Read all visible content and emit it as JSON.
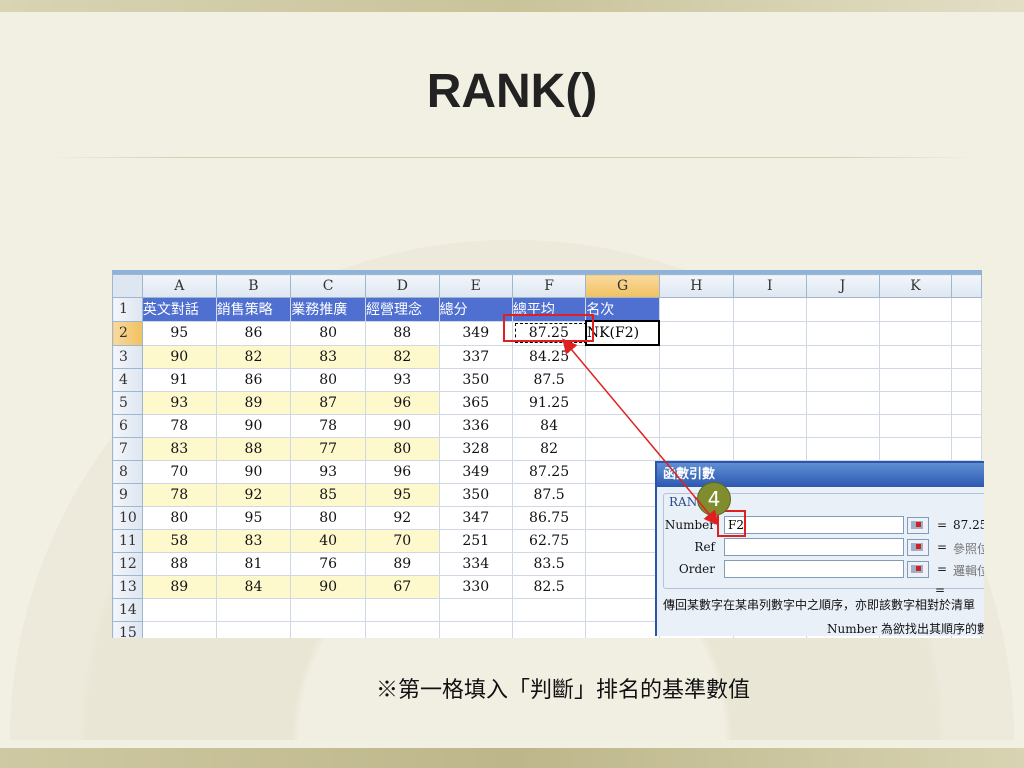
{
  "slide": {
    "title": "RANK()",
    "caption": "※第一格填入「判斷」排名的基準數值"
  },
  "sheet": {
    "columns": [
      "A",
      "B",
      "C",
      "D",
      "E",
      "F",
      "G",
      "H",
      "I",
      "J",
      "K"
    ],
    "header_row": [
      "英文對話",
      "銷售策略",
      "業務推廣",
      "經營理念",
      "總分",
      "總平均",
      "名次"
    ],
    "rows": [
      {
        "n": "1"
      },
      {
        "n": "2",
        "v": [
          "95",
          "86",
          "80",
          "88",
          "349",
          "87.25",
          "NK(F2)"
        ]
      },
      {
        "n": "3",
        "v": [
          "90",
          "82",
          "83",
          "82",
          "337",
          "84.25",
          ""
        ]
      },
      {
        "n": "4",
        "v": [
          "91",
          "86",
          "80",
          "93",
          "350",
          "87.5",
          ""
        ]
      },
      {
        "n": "5",
        "v": [
          "93",
          "89",
          "87",
          "96",
          "365",
          "91.25",
          ""
        ]
      },
      {
        "n": "6",
        "v": [
          "78",
          "90",
          "78",
          "90",
          "336",
          "84",
          ""
        ]
      },
      {
        "n": "7",
        "v": [
          "83",
          "88",
          "77",
          "80",
          "328",
          "82",
          ""
        ]
      },
      {
        "n": "8",
        "v": [
          "70",
          "90",
          "93",
          "96",
          "349",
          "87.25",
          ""
        ]
      },
      {
        "n": "9",
        "v": [
          "78",
          "92",
          "85",
          "95",
          "350",
          "87.5",
          ""
        ]
      },
      {
        "n": "10",
        "v": [
          "80",
          "95",
          "80",
          "92",
          "347",
          "86.75",
          ""
        ]
      },
      {
        "n": "11",
        "v": [
          "58",
          "83",
          "40",
          "70",
          "251",
          "62.75",
          ""
        ]
      },
      {
        "n": "12",
        "v": [
          "88",
          "81",
          "76",
          "89",
          "334",
          "83.5",
          ""
        ]
      },
      {
        "n": "13",
        "v": [
          "89",
          "84",
          "90",
          "67",
          "330",
          "82.5",
          ""
        ]
      },
      {
        "n": "14"
      },
      {
        "n": "15"
      }
    ]
  },
  "dialog": {
    "title": "函數引數",
    "group_label": "RANK",
    "step_badge": "4",
    "fields": [
      {
        "label": "Number",
        "value": "F2",
        "result": "87.25"
      },
      {
        "label": "Ref",
        "value": "",
        "result": "參照位"
      },
      {
        "label": "Order",
        "value": "",
        "result": "邏輯位"
      }
    ],
    "equals": "=",
    "description": "傳回某數字在某串列數字中之順序，亦即該數字相對於清單",
    "arg_help": "Number  為欲找出其順序的數"
  },
  "colors": {
    "header_blue": "#4f6fd1",
    "yellow_fill": "#fdf9cd",
    "highlight_red": "#e02020",
    "badge": "#7f8d2f"
  }
}
